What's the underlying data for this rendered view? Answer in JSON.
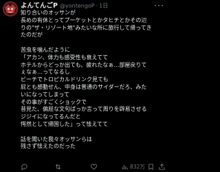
{
  "post": {
    "author": {
      "display_name": "よんてんごP",
      "handle": "@yontengoP",
      "separator": "·",
      "time": "1日"
    },
    "body_lines": [
      "知り合いのオッサンが",
      "長めの有休とってプーケットとかタヒチとかその辺",
      "りの\"ザ・リゾート地\"みたいな所に旅行して帰ってき",
      "たのだが",
      "",
      "苦虫を噛んだように",
      "「アカン、体力も感受性も衰えてて",
      "ホテルからどっか出ても、疲れたなぁ…部屋戻りて",
      "ぇなぁ…ってなるし",
      "ビーチでトロピカルドリンク見ても",
      "屁とも感動せん、中身は普通のサイダーだろ、みた",
      "いになってしまって",
      "その事がすごくショックで",
      "昔見た、偏屈な文句ばっか言って周りを辟易させる",
      "ジジイになってるんだと",
      "愕然として帰国した」って怯えてて",
      "",
      "話を聞いた我々オッサンらは",
      "残さず怯えたのだった"
    ],
    "stats": {
      "replies": "",
      "retweets": "",
      "likes": "",
      "views": "832万"
    }
  },
  "icons": {
    "more": "more-horizontal-icon",
    "reply": "reply-icon",
    "retweet": "retweet-icon",
    "like": "heart-icon",
    "views": "views-chart-icon",
    "bookmark": "bookmark-icon",
    "share": "share-icon"
  },
  "colors": {
    "background": "#000000",
    "text": "#e7e9ea",
    "muted": "#71767b",
    "avatar": "#5a1d1d"
  }
}
